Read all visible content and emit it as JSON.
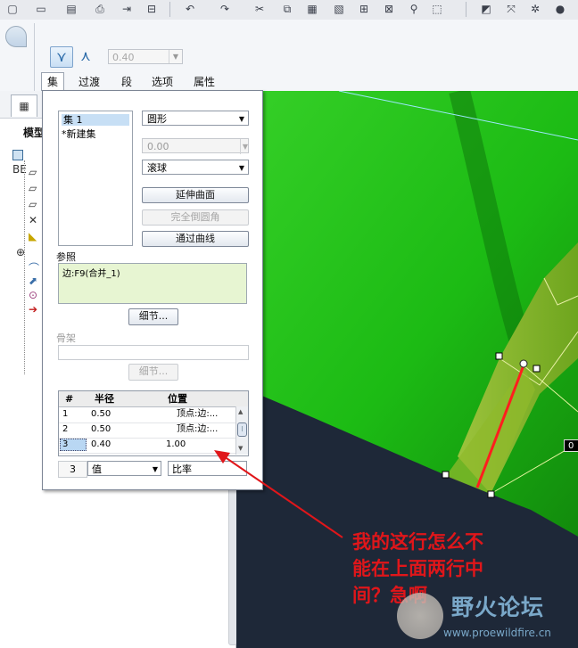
{
  "dashboard": {
    "radius_value": "0.40",
    "tabs": [
      "集",
      "过渡",
      "段",
      "选项",
      "属性"
    ]
  },
  "model_tree": {
    "title": "模型",
    "root_label": "BE"
  },
  "set_panel": {
    "sets": [
      "集 1",
      "*新建集"
    ],
    "shape": "圆形",
    "value_disabled": "0.00",
    "method": "滚球",
    "buttons": {
      "extend_surfaces": "延伸曲面",
      "full_round": "完全倒圆角",
      "through_curve": "通过曲线"
    },
    "references_label": "参照",
    "reference_text": "边:F9(合并_1)",
    "details_label": "细节...",
    "skeleton_label": "骨架",
    "table": {
      "headers": [
        "#",
        "半径",
        "位置"
      ],
      "rows": [
        [
          "1",
          "0.50",
          "顶点:边:..."
        ],
        [
          "2",
          "0.50",
          "顶点:边:..."
        ],
        [
          "3",
          "0.40",
          "1.00"
        ]
      ]
    },
    "row_count": "3",
    "value_type": "值",
    "position_type": "比率"
  },
  "viewport": {
    "dim_label": "0"
  },
  "annotation": {
    "text_lines": [
      "我的这行怎么不",
      "能在上面两行中",
      "间？急啊"
    ]
  },
  "watermark": {
    "brand": "野火论坛",
    "url": "www.proewildfire.cn"
  },
  "colors": {
    "model_green": "#1fbf16",
    "annotation_red": "#e0161a",
    "panel_selection": "#c7dff5"
  }
}
